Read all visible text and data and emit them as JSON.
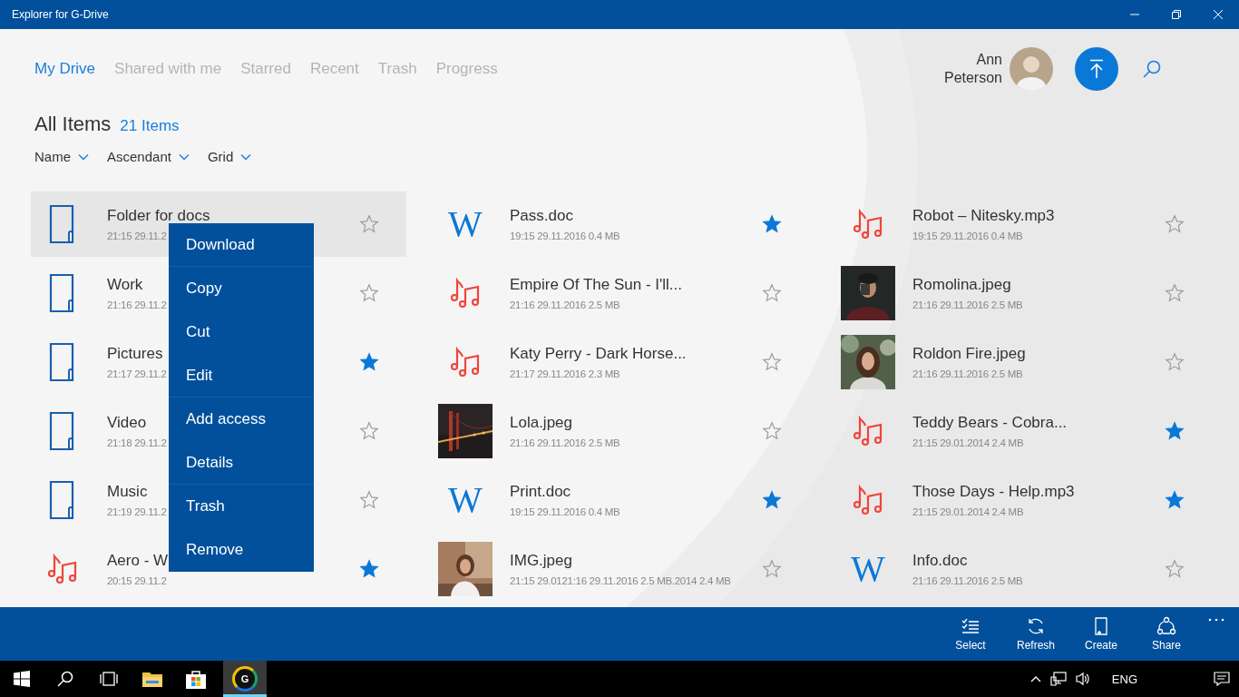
{
  "window": {
    "title": "Explorer for G-Drive"
  },
  "tabs": [
    {
      "label": "My Drive",
      "selected": true
    },
    {
      "label": "Shared with me",
      "selected": false
    },
    {
      "label": "Starred",
      "selected": false
    },
    {
      "label": "Recent",
      "selected": false
    },
    {
      "label": "Trash",
      "selected": false
    },
    {
      "label": "Progress",
      "selected": false
    }
  ],
  "user": {
    "name": "Ann Peterson"
  },
  "header": {
    "title": "All Items",
    "count": "21 Items"
  },
  "sort_controls": [
    {
      "label": "Name"
    },
    {
      "label": "Ascendant"
    },
    {
      "label": "Grid"
    }
  ],
  "items": [
    {
      "kind": "folder",
      "name": "Folder for docs",
      "meta": "21:15  29.11.2",
      "starred": false,
      "selected": true
    },
    {
      "kind": "folder",
      "name": "Work",
      "meta": "21:16  29.11.2",
      "starred": false,
      "selected": false
    },
    {
      "kind": "folder",
      "name": "Pictures",
      "meta": "21:17 29.11.2",
      "starred": true,
      "selected": false
    },
    {
      "kind": "folder",
      "name": "Video",
      "meta": "21:18  29.11.2",
      "starred": false,
      "selected": false
    },
    {
      "kind": "folder",
      "name": "Music",
      "meta": "21:19  29.11.2",
      "starred": false,
      "selected": false
    },
    {
      "kind": "music",
      "name": "Aero - W",
      "meta": "20:15  29.11.2",
      "starred": true,
      "selected": false
    },
    {
      "kind": "doc",
      "icon_text": "W",
      "name": "Pass.doc",
      "meta": "19:15  29.11.2016 0.4 MB",
      "starred": true,
      "selected": false
    },
    {
      "kind": "music",
      "name": "Empire Of The Sun - I'll...",
      "meta": "21:16  29.11.2016 2.5 MB",
      "starred": false,
      "selected": false
    },
    {
      "kind": "music",
      "name": "Katy Perry - Dark Horse...",
      "meta": "21:17 29.11.2016 2.3 MB",
      "starred": false,
      "selected": false
    },
    {
      "name": "Lola.jpeg",
      "meta": "21:16  29.11.2016 2.5 MB",
      "starred": false,
      "selected": false
    },
    {
      "kind": "doc",
      "icon_text": "W",
      "name": "Print.doc",
      "meta": "19:15  29.11.2016 0.4 MB",
      "starred": true,
      "selected": false
    },
    {
      "name": "IMG.jpeg",
      "meta": "21:15  29.0121:16  29.11.2016 2.5 MB.2014 2.4 MB",
      "starred": false,
      "selected": false
    },
    {
      "kind": "music",
      "name": "Robot – Nitesky.mp3",
      "meta": "19:15  29.11.2016 0.4 MB",
      "starred": false,
      "selected": false
    },
    {
      "name": "Romolina.jpeg",
      "meta": "21:16  29.11.2016 2.5 MB",
      "starred": false,
      "selected": false
    },
    {
      "name": "Roldon Fire.jpeg",
      "meta": "21:16  29.11.2016 2.5 MB",
      "starred": false,
      "selected": false
    },
    {
      "kind": "music",
      "name": "Teddy Bears - Cobra...",
      "meta": "21:15  29.01.2014 2.4 MB",
      "starred": true,
      "selected": false
    },
    {
      "kind": "music",
      "name": "Those Days - Help.mp3",
      "meta": "21:15  29.01.2014 2.4 MB",
      "starred": true,
      "selected": false
    },
    {
      "kind": "doc",
      "icon_text": "W",
      "name": "Info.doc",
      "meta": "21:16  29.11.2016 2.5 MB",
      "starred": false,
      "selected": false
    }
  ],
  "context_menu": {
    "items": [
      {
        "label": "Download",
        "separator": true
      },
      {
        "label": "Copy",
        "separator": false
      },
      {
        "label": "Cut",
        "separator": false
      },
      {
        "label": "Edit",
        "separator": true
      },
      {
        "label": "Add access",
        "separator": false
      },
      {
        "label": "Details",
        "separator": true
      },
      {
        "label": "Trash",
        "separator": false
      },
      {
        "label": "Remove",
        "separator": false
      }
    ]
  },
  "command_bar": [
    {
      "kind": "select",
      "label": "Select"
    },
    {
      "kind": "refresh",
      "label": "Refresh"
    },
    {
      "kind": "create",
      "label": "Create"
    },
    {
      "kind": "share",
      "label": "Share"
    }
  ],
  "taskbar": {
    "apps": [
      {
        "kind": "start",
        "active": false
      },
      {
        "kind": "search",
        "active": false
      },
      {
        "kind": "taskview",
        "active": false
      },
      {
        "kind": "explorer",
        "active": false
      },
      {
        "kind": "store",
        "active": false
      },
      {
        "kind": "gdrive",
        "icon_text": "G",
        "active": true
      }
    ],
    "language": "ENG"
  }
}
